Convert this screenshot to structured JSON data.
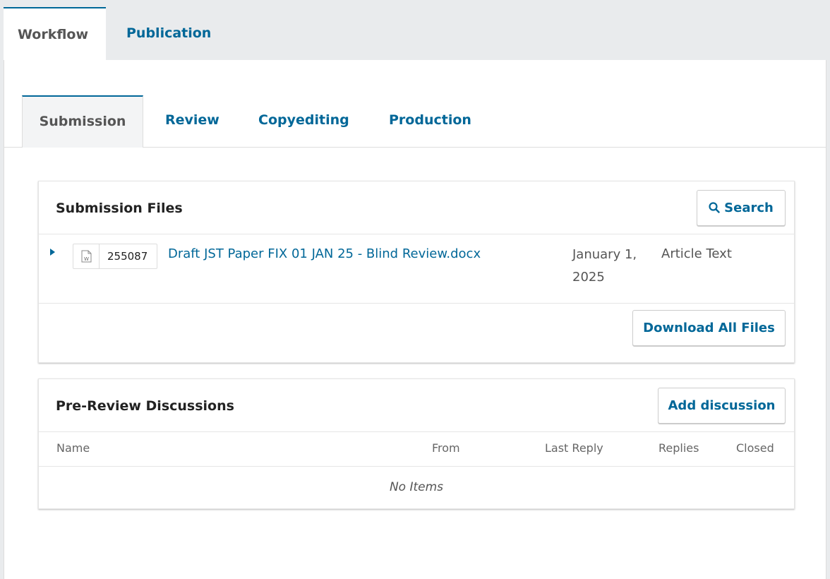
{
  "top_tabs": [
    "Workflow",
    "Publication"
  ],
  "sub_tabs": [
    "Submission",
    "Review",
    "Copyediting",
    "Production"
  ],
  "files_card": {
    "title": "Submission Files",
    "search_label": "Search",
    "file": {
      "id": "255087",
      "name": "Draft JST Paper FIX 01 JAN 25 - Blind Review.docx",
      "date": "January 1, 2025",
      "type": "Article Text"
    },
    "download_label": "Download All Files"
  },
  "discussions_card": {
    "title": "Pre-Review Discussions",
    "add_label": "Add discussion",
    "columns": [
      "Name",
      "From",
      "Last Reply",
      "Replies",
      "Closed"
    ],
    "empty_text": "No Items"
  },
  "colors": {
    "accent": "#006798",
    "background": "#e9ebed"
  }
}
